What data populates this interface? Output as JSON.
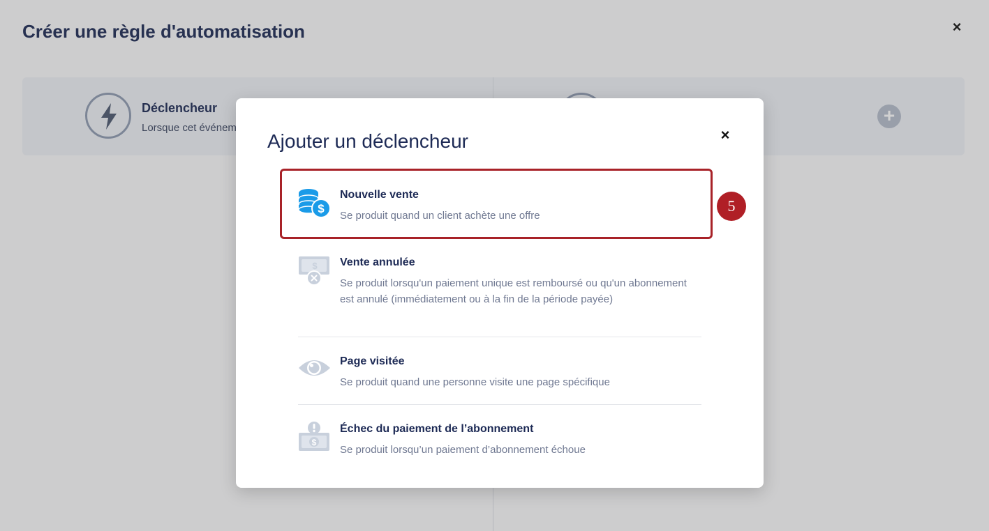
{
  "page": {
    "title": "Créer une règle d'automatisation",
    "close_glyph": "×",
    "trigger": {
      "title": "Déclencheur",
      "subtitle": "Lorsque cet événement"
    },
    "plus_glyph": "+"
  },
  "modal": {
    "title": "Ajouter un déclencheur",
    "close_glyph": "×",
    "step_badge": "5",
    "options": [
      {
        "title": "Nouvelle vente",
        "description": "Se produit quand un client achète une offre",
        "icon": "coins-dollar-icon"
      },
      {
        "title": "Vente annulée",
        "description": "Se produit lorsqu'un paiement unique est remboursé ou qu'un abonnement est annulé (immédiatement ou à la fin de la période payée)",
        "icon": "cancelled-sale-icon"
      },
      {
        "title": "Page visitée",
        "description": "Se produit quand une personne visite une page spécifique",
        "icon": "eye-icon"
      },
      {
        "title": "Échec du paiement de l’abonnement",
        "description": "Se produit lorsqu’un paiement d’abonnement échoue",
        "icon": "payment-failed-icon"
      }
    ]
  },
  "colors": {
    "title_navy": "#1d2a55",
    "highlight_red": "#a82228",
    "icon_blue": "#1a9be8",
    "icon_grey": "#c8d0dc"
  }
}
